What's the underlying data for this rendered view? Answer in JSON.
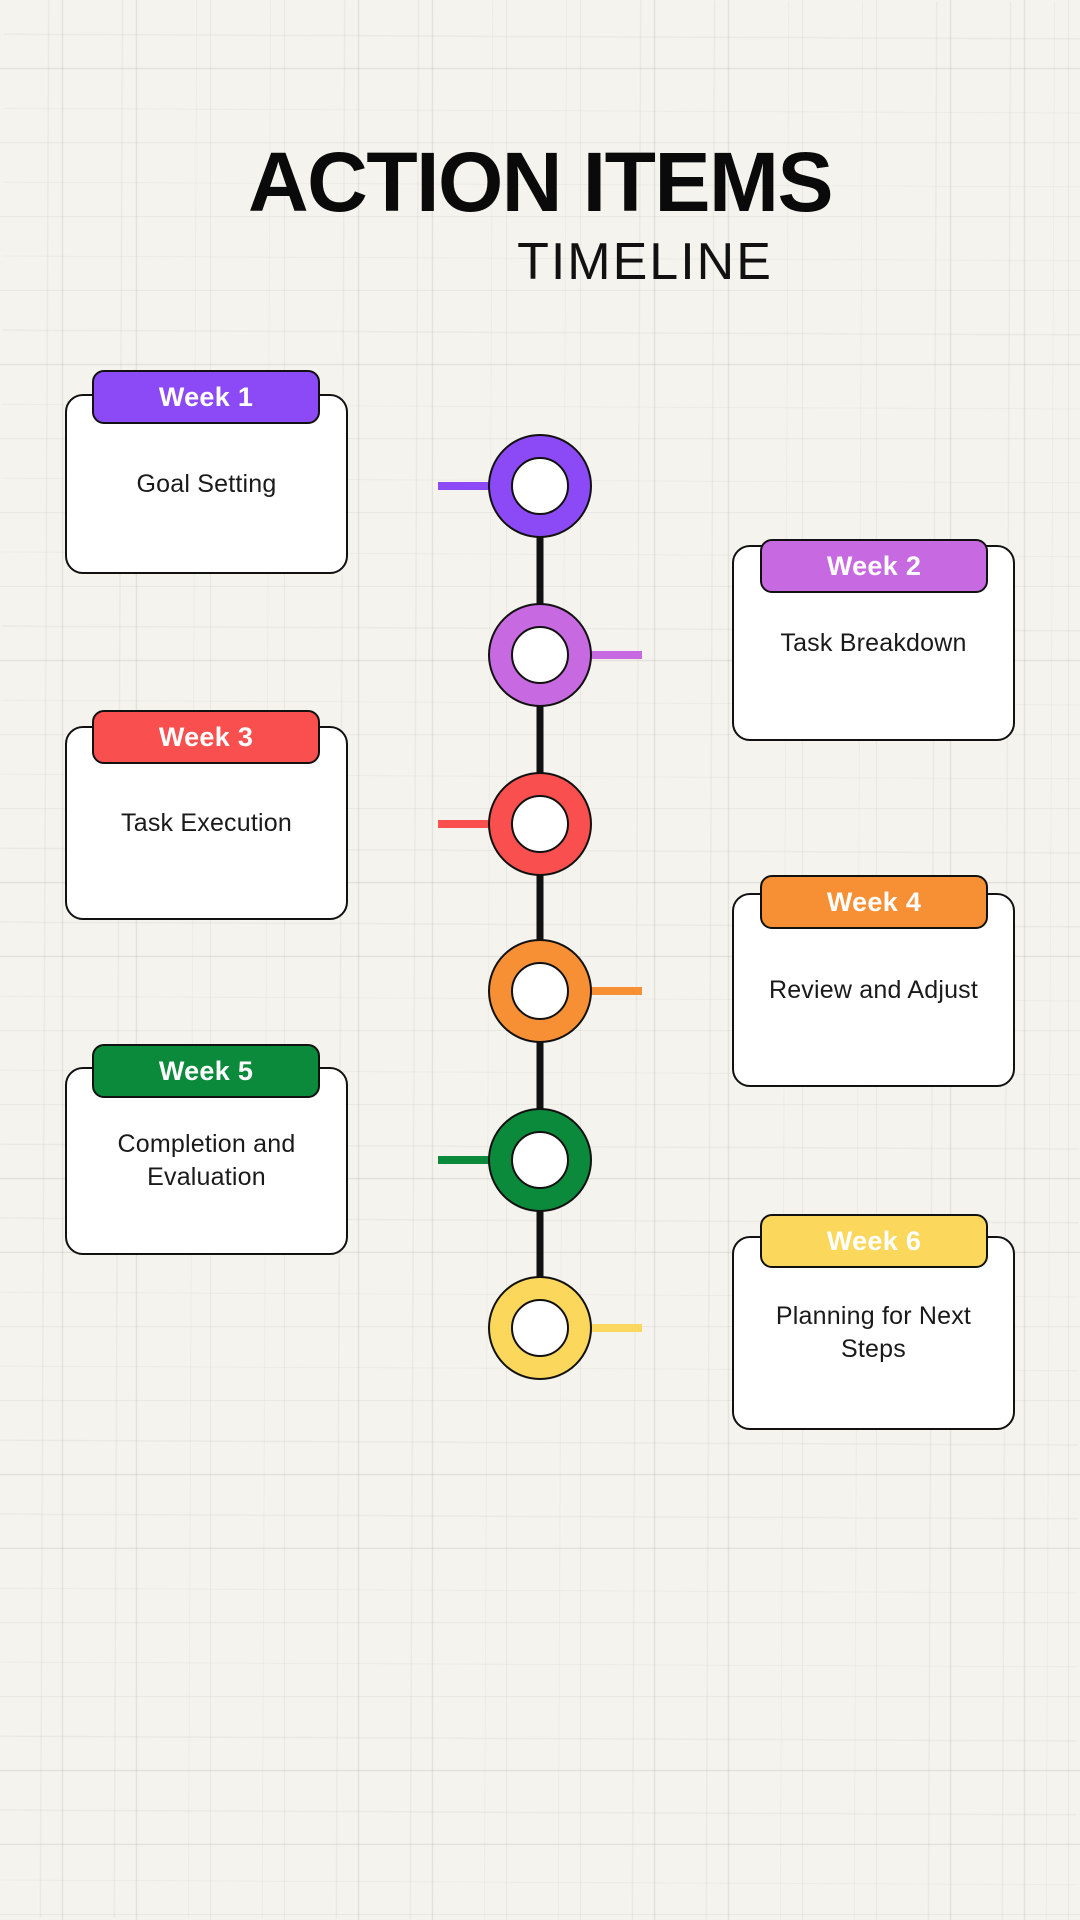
{
  "header": {
    "title": "ACTION ITEMS",
    "subtitle": "TIMELINE"
  },
  "theme": {
    "background": "#f4f3ee",
    "card_background": "#ffffff",
    "outline": "#111111",
    "spine": "#111111",
    "title_color": "#0a0a0a",
    "body_text_color": "#1a1a1a",
    "badge_text_color": "#ffffff"
  },
  "timeline": {
    "items": [
      {
        "week_label": "Week 1",
        "body": "Goal Setting",
        "color": "#8B4AF5",
        "side": "left"
      },
      {
        "week_label": "Week 2",
        "body": "Task Breakdown",
        "color": "#C769E0",
        "side": "right"
      },
      {
        "week_label": "Week 3",
        "body": "Task Execution",
        "color": "#F9504F",
        "side": "left"
      },
      {
        "week_label": "Week 4",
        "body": "Review and Adjust",
        "color": "#F78F35",
        "side": "right"
      },
      {
        "week_label": "Week 5",
        "body": "Completion and Evaluation",
        "color": "#0B8A3C",
        "side": "left"
      },
      {
        "week_label": "Week 6",
        "body": "Planning for Next Steps",
        "color": "#FBD75B",
        "side": "right"
      }
    ]
  }
}
